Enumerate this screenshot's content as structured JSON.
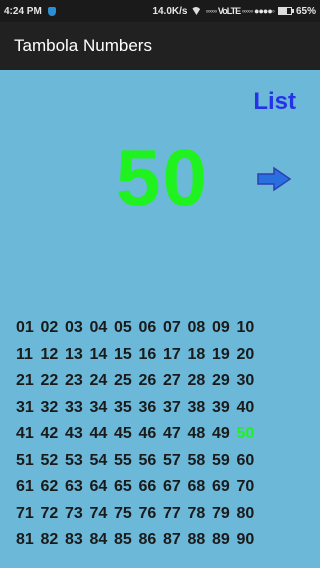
{
  "status_bar": {
    "time": "4:24 PM",
    "network_speed": "14.0K/s",
    "signal_text": "◦◦◦◦◦ VoLTE ◦◦◦◦◦ ●●●●◦",
    "battery_percent": "65%"
  },
  "app_bar": {
    "title": "Tambola Numbers"
  },
  "main": {
    "list_label": "List",
    "current_number": "50"
  },
  "grid": {
    "rows": [
      [
        "01",
        "02",
        "03",
        "04",
        "05",
        "06",
        "07",
        "08",
        "09",
        "10"
      ],
      [
        "11",
        "12",
        "13",
        "14",
        "15",
        "16",
        "17",
        "18",
        "19",
        "20"
      ],
      [
        "21",
        "22",
        "23",
        "24",
        "25",
        "26",
        "27",
        "28",
        "29",
        "30"
      ],
      [
        "31",
        "32",
        "33",
        "34",
        "35",
        "36",
        "37",
        "38",
        "39",
        "40"
      ],
      [
        "41",
        "42",
        "43",
        "44",
        "45",
        "46",
        "47",
        "48",
        "49",
        "50"
      ],
      [
        "51",
        "52",
        "53",
        "54",
        "55",
        "56",
        "57",
        "58",
        "59",
        "60"
      ],
      [
        "61",
        "62",
        "63",
        "64",
        "65",
        "66",
        "67",
        "68",
        "69",
        "70"
      ],
      [
        "71",
        "72",
        "73",
        "74",
        "75",
        "76",
        "77",
        "78",
        "79",
        "80"
      ],
      [
        "81",
        "82",
        "83",
        "84",
        "85",
        "86",
        "87",
        "88",
        "89",
        "90"
      ]
    ],
    "called_numbers": [
      "50"
    ]
  },
  "colors": {
    "background": "#6bb8d8",
    "app_bar": "#212121",
    "current_number": "#1ff21f",
    "list_link": "#2632e8",
    "arrow": "#2a6fe0"
  },
  "icons": {
    "shield": "shield-icon",
    "wifi": "wifi-icon",
    "battery": "battery-icon",
    "next": "right-arrow-icon"
  }
}
